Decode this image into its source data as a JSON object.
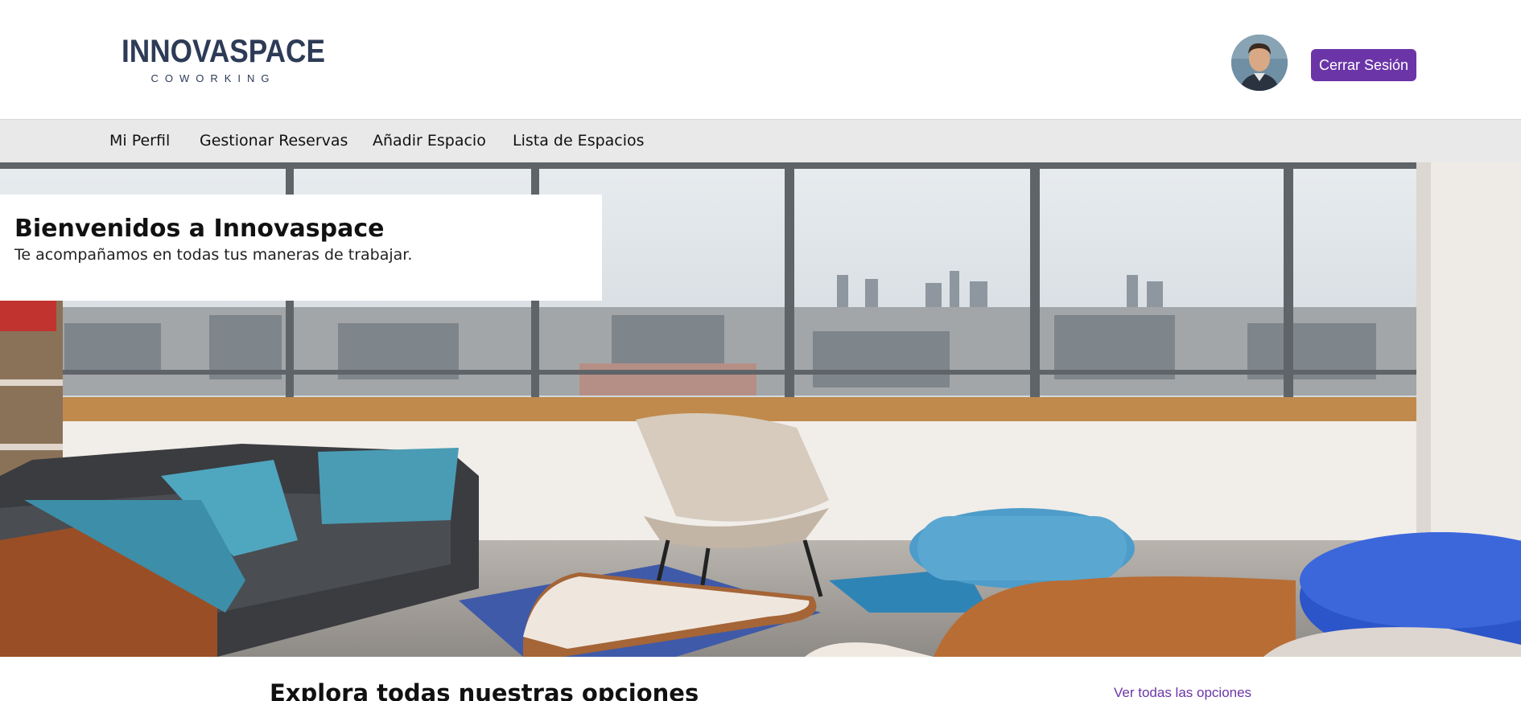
{
  "brand": {
    "name": "INNOVASPACE",
    "tagline": "COWORKING"
  },
  "header": {
    "logout_label": "Cerrar Sesión"
  },
  "nav": {
    "items": [
      {
        "label": "Mi Perfil"
      },
      {
        "label": "Gestionar Reservas"
      },
      {
        "label": "Añadir Espacio"
      },
      {
        "label": "Lista de Espacios"
      }
    ]
  },
  "hero": {
    "title": "Bienvenidos a Innovaspace",
    "subtitle": "Te acompañamos en todas tus maneras de trabajar."
  },
  "explore": {
    "title": "Explora todas nuestras opciones",
    "see_all_label": "Ver todas las opciones"
  },
  "colors": {
    "accent": "#6b35a8",
    "logo": "#2d3b57",
    "nav_bg": "#e9e9e9"
  }
}
